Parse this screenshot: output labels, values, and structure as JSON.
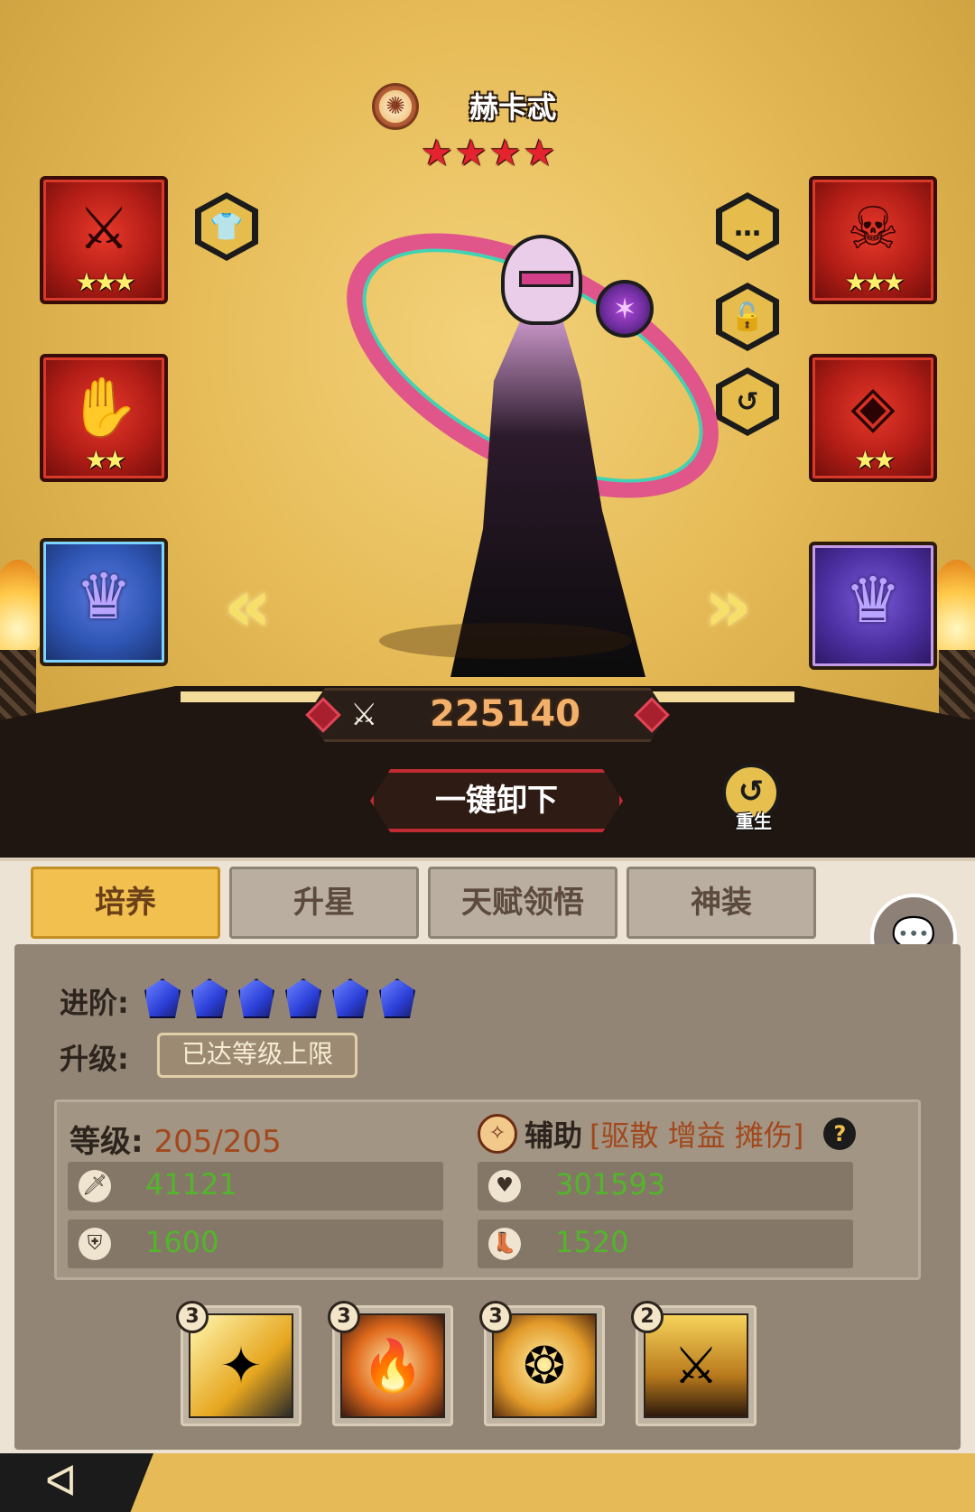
{
  "hero": {
    "name": "赫卡忒",
    "stars": "★★★★",
    "faction_icon": "swirl-icon"
  },
  "equipment": {
    "left": [
      {
        "name": "weapon",
        "stars": "★★★",
        "emblem": "⚔"
      },
      {
        "name": "gloves",
        "stars": "★★",
        "emblem": "✋"
      }
    ],
    "right": [
      {
        "name": "helmet",
        "stars": "★★★",
        "emblem": "☠"
      },
      {
        "name": "armor",
        "stars": "★★",
        "emblem": "◈"
      }
    ],
    "left_artifact": "♛",
    "right_artifact": "♛"
  },
  "side_buttons": {
    "outfit": "👕",
    "chat": "…",
    "lock": "🔓",
    "swap": "↺"
  },
  "nav": {
    "prev": "«",
    "next": "»"
  },
  "power": {
    "icon": "⚔",
    "value": "225140"
  },
  "actions": {
    "unequip_all": "一键卸下",
    "rebirth_icon": "↺",
    "rebirth": "重生"
  },
  "tabs": [
    "培养",
    "升星",
    "天赋领悟",
    "神装"
  ],
  "chat_icon": "💬",
  "advance": {
    "label": "进阶:",
    "gems": 6
  },
  "upgrade": {
    "label": "升级:",
    "status": "已达等级上限"
  },
  "stats": {
    "level_label": "等级:",
    "level_value": "205/205",
    "role_name": "辅助",
    "role_tags": "[驱散 增益 摊伤]",
    "help": "?",
    "attack": "41121",
    "hp": "301593",
    "defense": "1600",
    "speed": "1520"
  },
  "skills": [
    {
      "level": "3",
      "name": "light-strike",
      "glyph": "✦"
    },
    {
      "level": "3",
      "name": "flame-orb",
      "glyph": "🔥"
    },
    {
      "level": "3",
      "name": "winged-crest",
      "glyph": "❂"
    },
    {
      "level": "2",
      "name": "sword-guardian",
      "glyph": "⚔"
    }
  ],
  "back": "ᐊ"
}
